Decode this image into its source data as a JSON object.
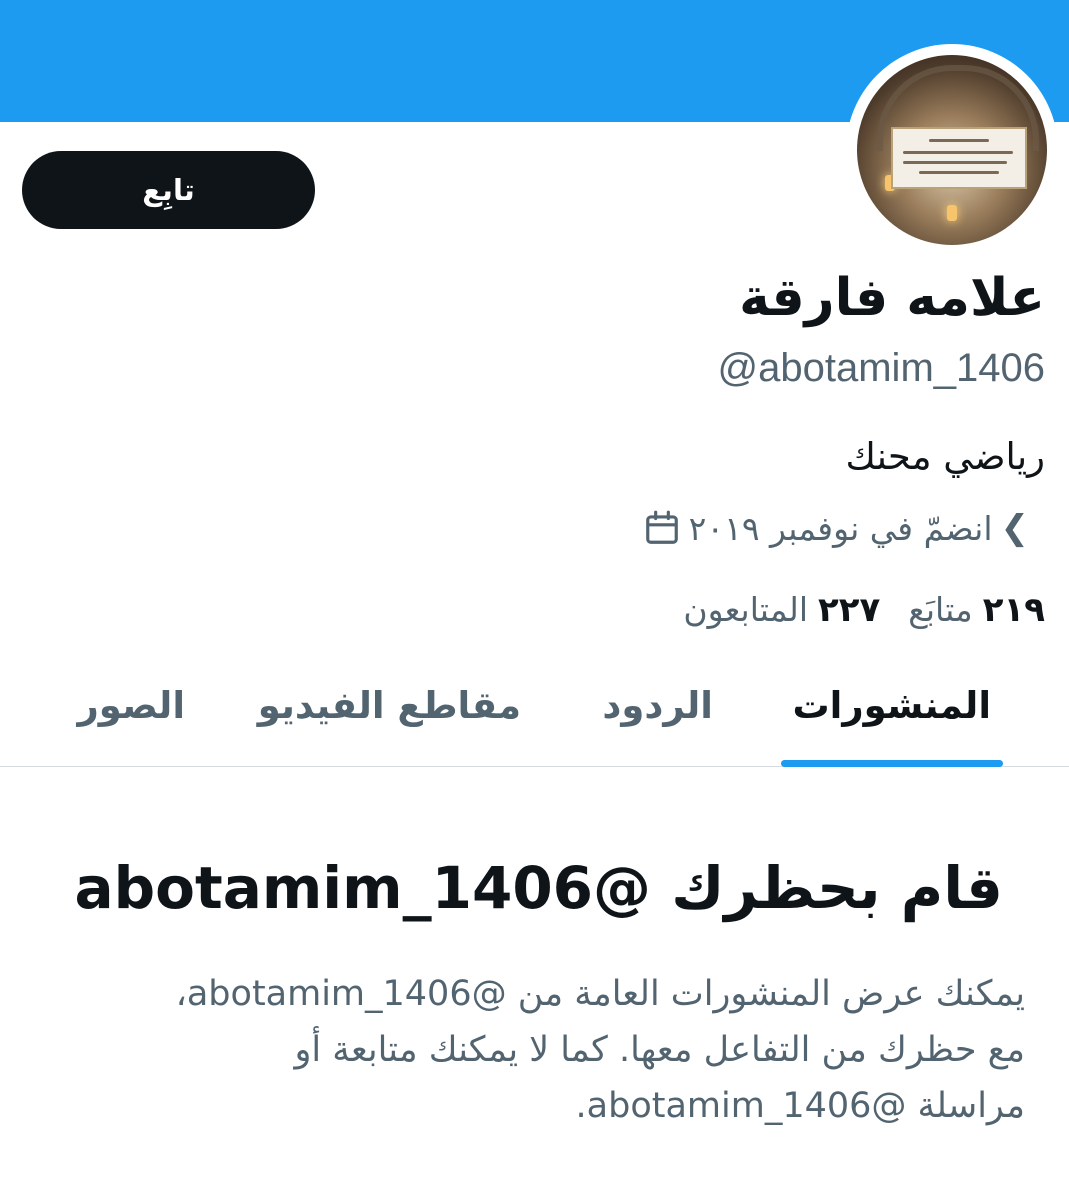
{
  "profile": {
    "display_name": "علامه فارقة",
    "handle": "@abotamim_1406",
    "bio": "رياضي محنك",
    "joined": "انضمّ في نوفمبر ٢٠١٩",
    "joined_icon": "calendar-icon",
    "chevron_icon": "chevron-left-icon"
  },
  "actions": {
    "follow_label": "تابِع"
  },
  "stats": {
    "following_count": "٢١٩",
    "following_label": "متابَع",
    "followers_count": "٢٢٧",
    "followers_label": "المتابعون"
  },
  "tabs": [
    {
      "label": "المنشورات",
      "active": true
    },
    {
      "label": "الردود",
      "active": false
    },
    {
      "label": "مقاطع الفيديو",
      "active": false
    },
    {
      "label": "الصور",
      "active": false
    }
  ],
  "blocked": {
    "title": "قام بحظرك @abotamim_1406",
    "description_lines": [
      "يمكنك عرض المنشورات العامة من @abotamim_1406،",
      "مع حظرك من التفاعل معها. كما لا يمكنك متابعة أو",
      "مراسلة @abotamim_1406."
    ]
  },
  "colors": {
    "banner": "#1d9bf0",
    "accent": "#1d9bf0",
    "button_bg": "#0f1419",
    "secondary_text": "#536471"
  }
}
